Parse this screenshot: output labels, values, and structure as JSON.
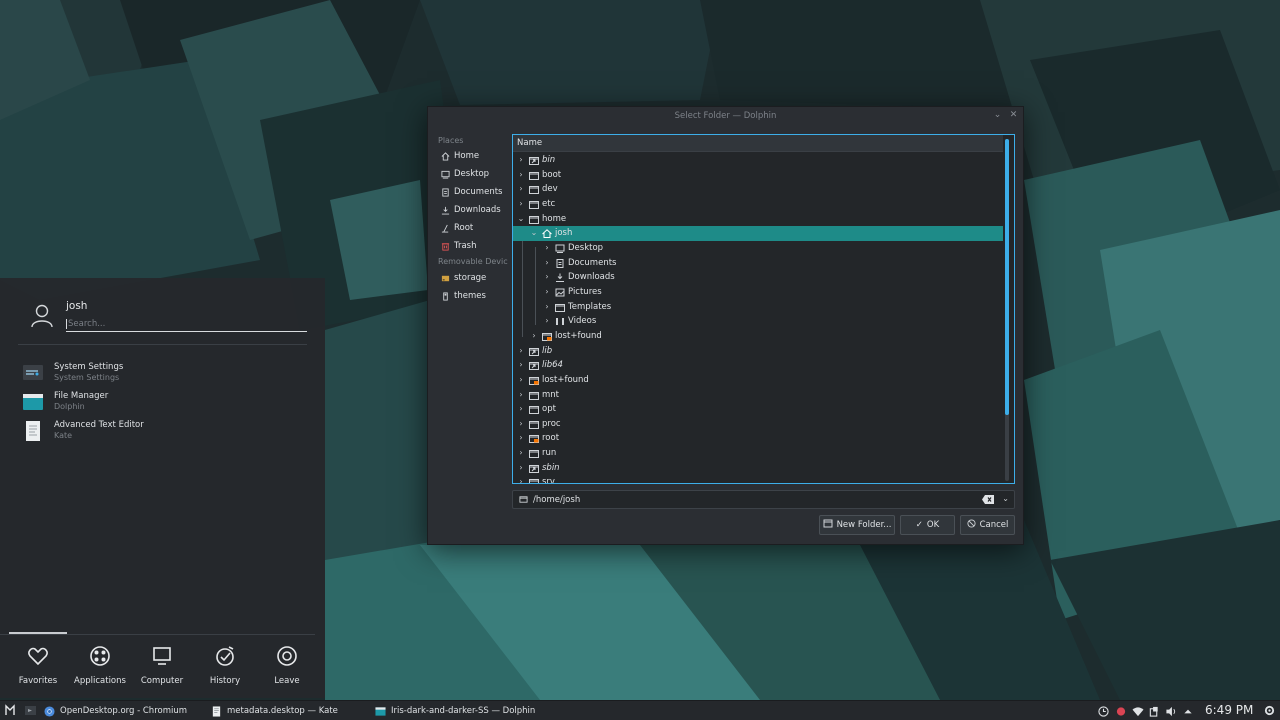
{
  "dialog": {
    "title": "Select Folder — Dolphin",
    "places_header": "Places",
    "places": [
      {
        "label": "Home",
        "icon": "home-icon"
      },
      {
        "label": "Desktop",
        "icon": "desktop-icon"
      },
      {
        "label": "Documents",
        "icon": "documents-icon"
      },
      {
        "label": "Downloads",
        "icon": "downloads-icon"
      },
      {
        "label": "Root",
        "icon": "root-icon"
      },
      {
        "label": "Trash",
        "icon": "trash-icon"
      }
    ],
    "removable_header": "Removable Devic",
    "removable": [
      {
        "label": "storage",
        "icon": "drive-icon"
      },
      {
        "label": "themes",
        "icon": "usb-icon"
      }
    ],
    "column_header": "Name",
    "tree": [
      {
        "label": "bin",
        "level": 0,
        "arrow": "›",
        "italic": true,
        "icon": "folder-link-icon"
      },
      {
        "label": "boot",
        "level": 0,
        "arrow": "›",
        "icon": "folder-icon"
      },
      {
        "label": "dev",
        "level": 0,
        "arrow": "›",
        "icon": "folder-icon"
      },
      {
        "label": "etc",
        "level": 0,
        "arrow": "›",
        "icon": "folder-icon"
      },
      {
        "label": "home",
        "level": 0,
        "arrow": "⌄",
        "icon": "folder-icon"
      },
      {
        "label": "josh",
        "level": 1,
        "arrow": "⌄",
        "icon": "home-folder-icon",
        "selected": true
      },
      {
        "label": "Desktop",
        "level": 2,
        "arrow": "›",
        "icon": "desktop-folder-icon"
      },
      {
        "label": "Documents",
        "level": 2,
        "arrow": "›",
        "icon": "documents-folder-icon"
      },
      {
        "label": "Downloads",
        "level": 2,
        "arrow": "›",
        "icon": "downloads-folder-icon"
      },
      {
        "label": "Pictures",
        "level": 2,
        "arrow": "›",
        "icon": "pictures-folder-icon"
      },
      {
        "label": "Templates",
        "level": 2,
        "arrow": "›",
        "icon": "templates-folder-icon"
      },
      {
        "label": "Videos",
        "level": 2,
        "arrow": "›",
        "icon": "videos-folder-icon"
      },
      {
        "label": "lost+found",
        "level": 1,
        "arrow": "›",
        "icon": "locked-folder-icon"
      },
      {
        "label": "lib",
        "level": 0,
        "arrow": "›",
        "italic": true,
        "icon": "folder-link-icon"
      },
      {
        "label": "lib64",
        "level": 0,
        "arrow": "›",
        "italic": true,
        "icon": "folder-link-icon"
      },
      {
        "label": "lost+found",
        "level": 0,
        "arrow": "›",
        "icon": "locked-folder-icon"
      },
      {
        "label": "mnt",
        "level": 0,
        "arrow": "›",
        "icon": "folder-icon"
      },
      {
        "label": "opt",
        "level": 0,
        "arrow": "›",
        "icon": "folder-icon"
      },
      {
        "label": "proc",
        "level": 0,
        "arrow": "›",
        "icon": "folder-icon"
      },
      {
        "label": "root",
        "level": 0,
        "arrow": "›",
        "icon": "locked-folder-icon"
      },
      {
        "label": "run",
        "level": 0,
        "arrow": "›",
        "icon": "folder-icon"
      },
      {
        "label": "sbin",
        "level": 0,
        "arrow": "›",
        "italic": true,
        "icon": "folder-link-icon"
      },
      {
        "label": "srv",
        "level": 0,
        "arrow": "›",
        "icon": "folder-icon"
      }
    ],
    "path": "/home/josh",
    "buttons": {
      "new_folder": "New Folder...",
      "ok": "OK",
      "cancel": "Cancel"
    }
  },
  "launcher": {
    "username": "josh",
    "search_placeholder": "Search...",
    "favorites": [
      {
        "name": "System Settings",
        "sub": "System Settings",
        "icon": "system-settings-icon"
      },
      {
        "name": "File Manager",
        "sub": "Dolphin",
        "icon": "file-manager-icon"
      },
      {
        "name": "Advanced Text Editor",
        "sub": "Kate",
        "icon": "text-editor-icon"
      }
    ],
    "tabs": [
      {
        "label": "Favorites",
        "icon": "heart-icon"
      },
      {
        "label": "Applications",
        "icon": "applications-icon"
      },
      {
        "label": "Computer",
        "icon": "computer-icon"
      },
      {
        "label": "History",
        "icon": "history-icon"
      },
      {
        "label": "Leave",
        "icon": "leave-icon"
      }
    ]
  },
  "taskbar": {
    "tasks": [
      {
        "label": "OpenDesktop.org - Chromium",
        "icon": "chromium-icon"
      },
      {
        "label": "metadata.desktop  — Kate",
        "icon": "document-icon"
      },
      {
        "label": "Iris-dark-and-darker-SS — Dolphin",
        "icon": "dolphin-icon"
      }
    ],
    "clock": "6:49 PM"
  },
  "colors": {
    "accent": "#3daee9",
    "selection": "#1e8b88",
    "dialog_bg": "#2b2e33",
    "view_bg": "#232629",
    "wallpaper": "#1f3133"
  }
}
